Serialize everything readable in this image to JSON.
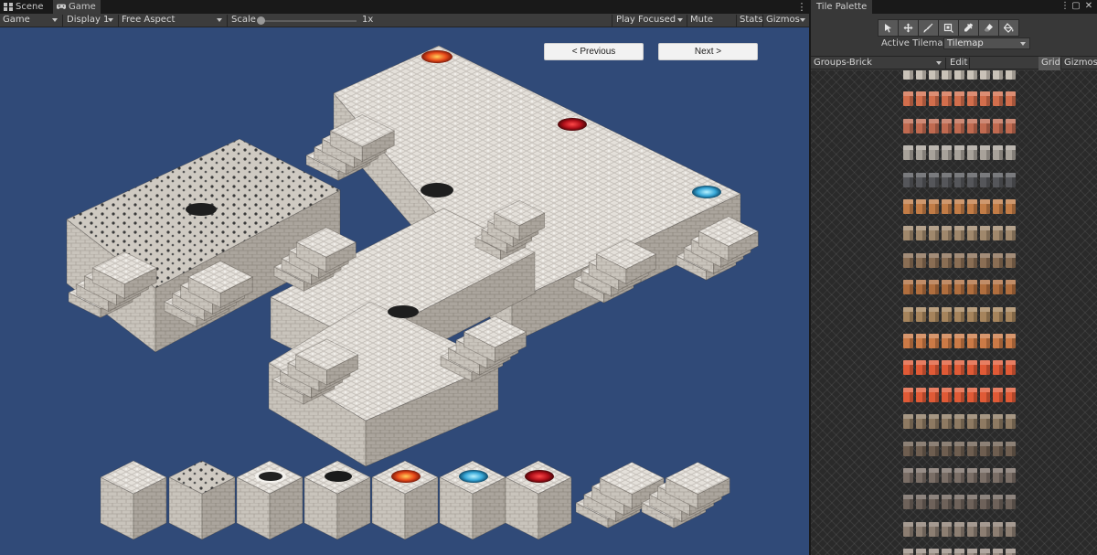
{
  "left_window": {
    "tabs": [
      {
        "label": "Scene",
        "icon": "grid-icon",
        "active": false
      },
      {
        "label": "Game",
        "icon": "gamepad-icon",
        "active": true
      }
    ],
    "toolbar": {
      "view_select": "Game",
      "display_select": "Display 1",
      "aspect_select": "Free Aspect",
      "scale_label": "Scale",
      "scale_value": "1x",
      "play_focused": "Play Focused",
      "mute_audio": "Mute Audio",
      "stats": "Stats",
      "gizmos": "Gizmos"
    },
    "game": {
      "previous_label": "< Previous",
      "next_label": "Next >",
      "background_color": "#304a78"
    }
  },
  "tile_palette": {
    "tab_label": "Tile Palette",
    "tools": [
      "select-icon",
      "move-icon",
      "paint-brush-icon",
      "box-fill-icon",
      "picker-icon",
      "eraser-icon",
      "flood-fill-icon"
    ],
    "active_tilemap_label": "Active Tilemap",
    "active_tilemap_value": "Tilemap",
    "palette_select": "Groups-Brick",
    "edit_label": "Edit",
    "grid_label": "Grid",
    "gizmos_label": "Gizmos",
    "row_colors": [
      "#c9c2b8",
      "#d26e4c",
      "#c06a50",
      "#a8a29a",
      "#55565a",
      "#c27c46",
      "#a0886c",
      "#8a6e54",
      "#b06e3e",
      "#a6845c",
      "#cc7a46",
      "#e05a36",
      "#e05a36",
      "#8e7a62",
      "#6e5e50",
      "#7a6e66",
      "#6e625a",
      "#8c7e72",
      "#9a8e84"
    ]
  }
}
